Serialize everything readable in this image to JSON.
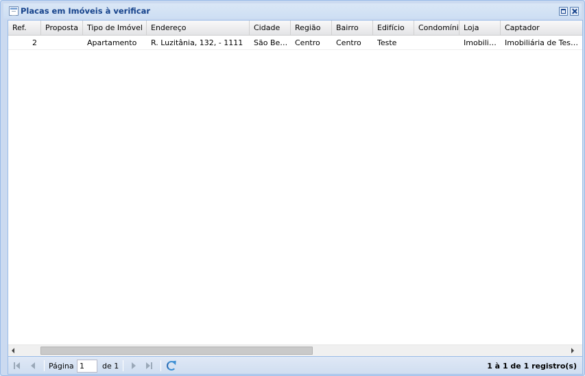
{
  "window": {
    "title": "Placas em Imóveis à verificar"
  },
  "grid": {
    "columns": [
      "Ref.",
      "Proposta",
      "Tipo de Imóvel",
      "Endereço",
      "Cidade",
      "Região",
      "Bairro",
      "Edifício",
      "Condomínio",
      "Loja",
      "Captador"
    ],
    "rows": [
      {
        "ref": "2",
        "proposta": "",
        "tipo": "Apartamento",
        "endereco": "R. Luzitânia, 132, - 1111",
        "cidade": "São Ber...",
        "regiao": "Centro",
        "bairro": "Centro",
        "edificio": "Teste",
        "condominio": "",
        "loja": "Imobiliá...",
        "captador": "Imobiliária de Testes"
      }
    ]
  },
  "pager": {
    "page_label": "Página",
    "page_value": "1",
    "of_label": "de 1",
    "info": "1 à 1 de 1 registro(s)"
  }
}
